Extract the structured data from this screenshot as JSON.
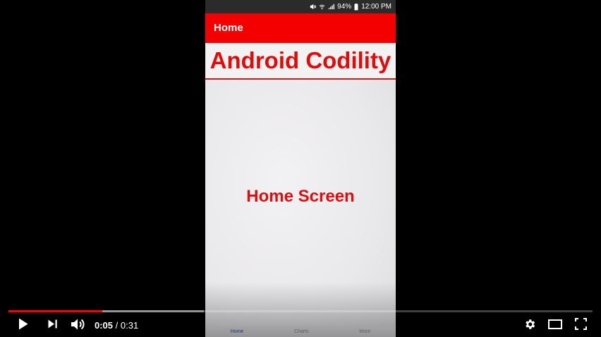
{
  "status_bar": {
    "battery": "94%",
    "clock": "12:00 PM"
  },
  "app": {
    "app_bar_title": "Home",
    "banner_text": "Android Codility",
    "screen_text": "Home Screen",
    "bottom_nav": [
      "Home",
      "Charts",
      "More"
    ],
    "accent_color": "#f50000"
  },
  "player": {
    "time_current": "0:05",
    "time_separator": " / ",
    "time_total": "0:31",
    "played_fraction": 0.161,
    "loaded_fraction": 0.335,
    "progress_color": "#ff0000",
    "left_controls": [
      "play-icon",
      "next-icon",
      "volume-icon"
    ],
    "right_controls": [
      "settings-icon",
      "theater-mode-icon",
      "fullscreen-icon"
    ]
  }
}
